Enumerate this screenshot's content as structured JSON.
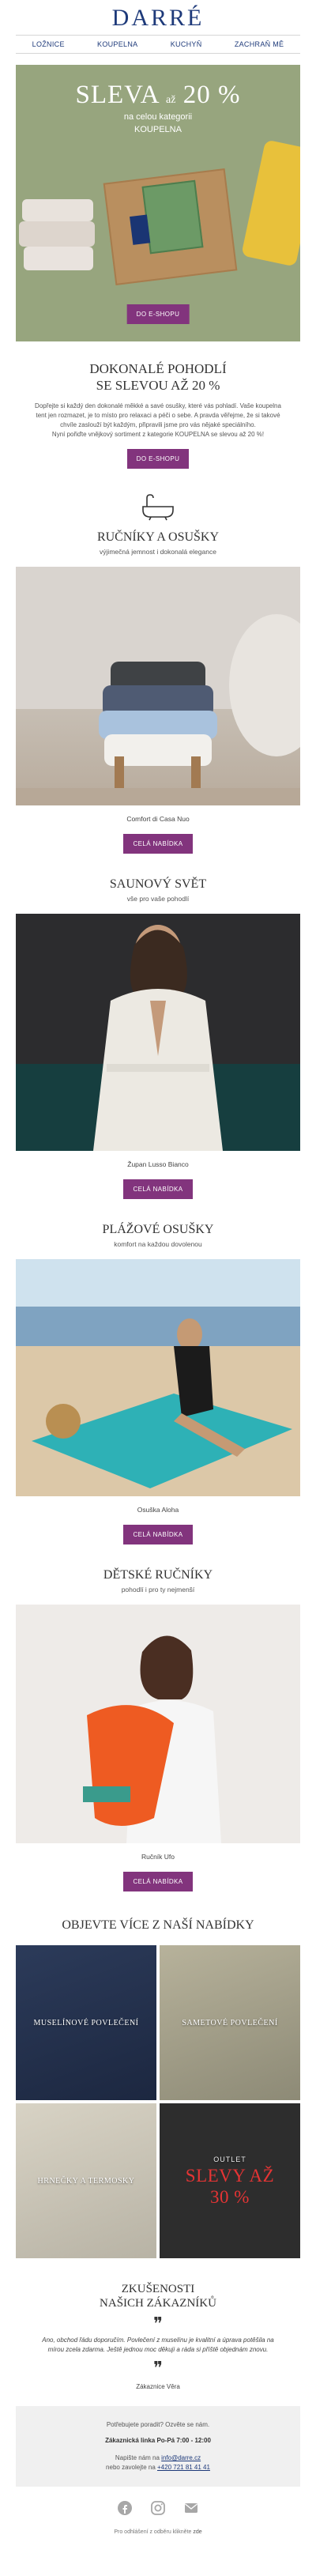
{
  "brand": {
    "logo": "DARRÉ"
  },
  "nav": [
    "LOŽNICE",
    "KOUPELNA",
    "KUCHYŇ",
    "ZACHRAŇ MĚ"
  ],
  "hero": {
    "sleva": "SLEVA",
    "az": "až",
    "percent": "20 %",
    "sub1": "na celou kategorii",
    "sub2": "KOUPELNA",
    "button": "DO E-SHOPU"
  },
  "intro": {
    "title1": "DOKONALÉ POHODLÍ",
    "title2": "SE SLEVOU AŽ 20 %",
    "text": "Dopřejte si každý den dokonalé měkké a savé osušky, které vás pohladí. Vaše koupelna tent jen rozmazet, je to místo pro relaxaci a péči o sebe. A pravda věřejme, že si takové chvíle zaslouží být každým, připravili jsme pro vás nějaké speciálního.",
    "text2": "Nyní pořiďte vnějkový sortiment z kategorie KOUPELNA se slevou až 20 %!",
    "button": "DO E-SHOPU"
  },
  "sections": [
    {
      "title": "RUČNÍKY A OSUŠKY",
      "sub": "výjimečná jemnost i dokonalá elegance",
      "caption": "Comfort di Casa Nuo",
      "button": "CELÁ NABÍDKA"
    },
    {
      "title": "SAUNOVÝ SVĚT",
      "sub": "vše pro vaše pohodlí",
      "caption": "Župan Lusso Bianco",
      "button": "CELÁ NABÍDKA"
    },
    {
      "title": "PLÁŽOVÉ OSUŠKY",
      "sub": "komfort na každou dovolenou",
      "caption": "Osuška Aloha",
      "button": "CELÁ NABÍDKA"
    },
    {
      "title": "DĚTSKÉ RUČNÍKY",
      "sub": "pohodlí i pro ty nejmenší",
      "caption": "Ručník Ufo",
      "button": "CELÁ NABÍDKA"
    }
  ],
  "more": {
    "title": "OBJEVTE VÍCE Z NAŠÍ NABÍDKY",
    "tiles": [
      "MUSELÍNOVÉ POVLEČENÍ",
      "SAMETOVÉ POVLEČENÍ",
      "HRNEČKY A TERMOSKY"
    ],
    "outlet_label": "OUTLET",
    "outlet_discount": "SLEVY AŽ 30 %"
  },
  "reviews": {
    "title1": "ZKUŠENOSTI",
    "title2": "NAŠICH ZÁKAZNÍKŮ",
    "quote": "Ano, obchod řádu doporučím. Povlečení z muselínu je kvalitní a úprava potěšila na mírou zcela zdarma. Ještě jednou moc děkuji a ráda si příště objednám znovu.",
    "author": "Zákaznice Věra"
  },
  "footer": {
    "help": "Potřebujete poradit? Ozvěte se nám.",
    "line": "Zákaznická linka Po-Pá 7:00 - 12:00",
    "write": "Napište nám na",
    "email": "info@darre.cz",
    "call": "nebo zavolejte na",
    "phone": "+420 721 81 41 41",
    "unsub_prefix": "Pro odhlášení z odběru klikněte",
    "unsub_link": "zde"
  },
  "colors": {
    "accent": "#82347d",
    "brand": "#1e3a7a",
    "hero_bg": "#97a57e"
  }
}
